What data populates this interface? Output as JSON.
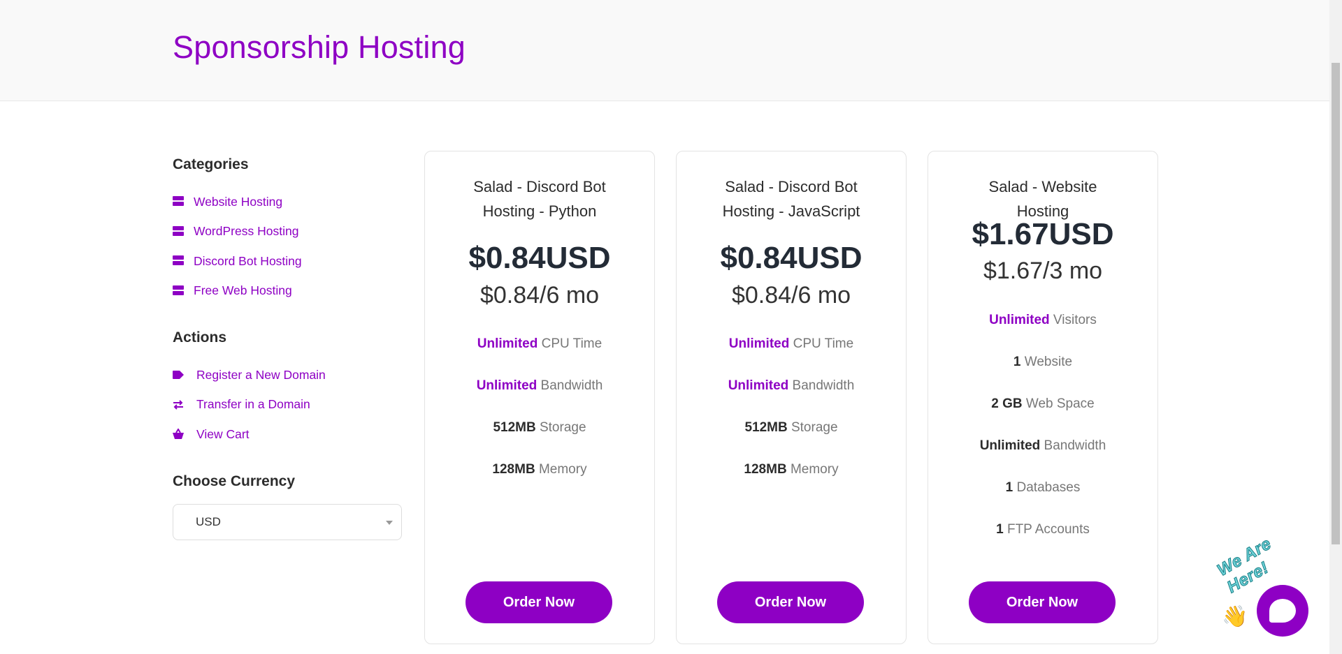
{
  "header": {
    "title": "Sponsorship Hosting"
  },
  "sidebar": {
    "categories_heading": "Categories",
    "categories": [
      {
        "label": "Website Hosting",
        "icon": "server-icon"
      },
      {
        "label": "WordPress Hosting",
        "icon": "server-icon"
      },
      {
        "label": "Discord Bot Hosting",
        "icon": "server-icon"
      },
      {
        "label": "Free Web Hosting",
        "icon": "server-icon"
      }
    ],
    "actions_heading": "Actions",
    "actions": [
      {
        "label": "Register a New Domain",
        "icon": "tag-icon"
      },
      {
        "label": "Transfer in a Domain",
        "icon": "transfer-icon"
      },
      {
        "label": "View Cart",
        "icon": "cart-icon"
      }
    ],
    "currency_heading": "Choose Currency",
    "currency_selected": "USD"
  },
  "products": [
    {
      "title": "Salad - Discord Bot Hosting - Python",
      "price": "$0.84USD",
      "period": "$0.84/6 mo",
      "features": [
        {
          "value": "Unlimited",
          "label": " CPU Time",
          "highlight": true
        },
        {
          "value": "Unlimited",
          "label": " Bandwidth",
          "highlight": true
        },
        {
          "value": "512MB",
          "label": " Storage",
          "highlight": false
        },
        {
          "value": "128MB",
          "label": " Memory",
          "highlight": false
        }
      ],
      "button": "Order Now"
    },
    {
      "title": "Salad - Discord Bot Hosting - JavaScript",
      "price": "$0.84USD",
      "period": "$0.84/6 mo",
      "features": [
        {
          "value": "Unlimited",
          "label": " CPU Time",
          "highlight": true
        },
        {
          "value": "Unlimited",
          "label": " Bandwidth",
          "highlight": true
        },
        {
          "value": "512MB",
          "label": " Storage",
          "highlight": false
        },
        {
          "value": "128MB",
          "label": " Memory",
          "highlight": false
        }
      ],
      "button": "Order Now"
    },
    {
      "title": "Salad - Website Hosting",
      "price": "$1.67USD",
      "period": "$1.67/3 mo",
      "features": [
        {
          "value": "Unlimited",
          "label": " Visitors",
          "highlight": true
        },
        {
          "value": "1",
          "label": " Website",
          "highlight": false
        },
        {
          "value": "2 GB",
          "label": " Web Space",
          "highlight": false
        },
        {
          "value": "Unlimited",
          "label": " Bandwidth",
          "highlight": false
        },
        {
          "value": "1",
          "label": " Databases",
          "highlight": false
        },
        {
          "value": "1",
          "label": " FTP Accounts",
          "highlight": false
        }
      ],
      "button": "Order Now"
    }
  ],
  "chat": {
    "tagline": "We Are Here!"
  },
  "colors": {
    "accent": "#8e00c4",
    "header_bg": "#f9f9f9"
  }
}
